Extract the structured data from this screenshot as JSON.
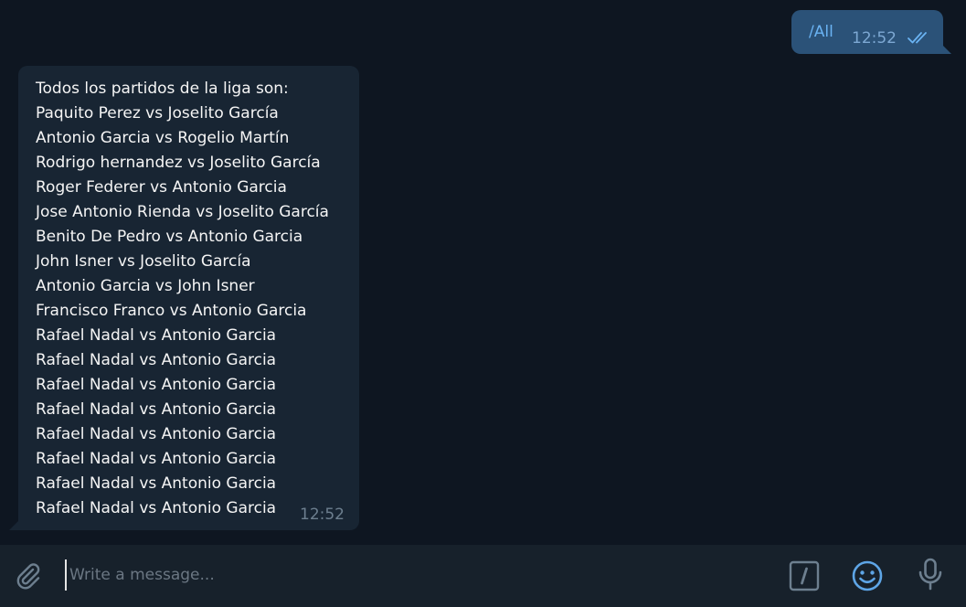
{
  "messages": {
    "outgoing": {
      "text": "/All",
      "time": "12:52",
      "status_icon": "double-check-icon"
    },
    "incoming": {
      "lines": [
        "Todos los partidos de la liga son:",
        "Paquito Perez vs Joselito García",
        "Antonio Garcia vs Rogelio Martín",
        "Rodrigo hernandez vs Joselito García",
        "Roger Federer vs Antonio Garcia",
        "Jose Antonio Rienda vs Joselito García",
        "Benito De Pedro vs Antonio Garcia",
        "John Isner vs Joselito García",
        "Antonio Garcia vs John Isner",
        "Francisco Franco vs Antonio Garcia",
        "Rafael Nadal vs Antonio Garcia",
        "Rafael Nadal vs Antonio Garcia",
        "Rafael Nadal vs Antonio Garcia",
        "Rafael Nadal vs Antonio Garcia",
        "Rafael Nadal vs Antonio Garcia",
        "Rafael Nadal vs Antonio Garcia",
        "Rafael Nadal vs Antonio Garcia",
        "Rafael Nadal vs Antonio Garcia"
      ],
      "time": "12:52"
    }
  },
  "composer": {
    "placeholder": "Write a message...",
    "icons": {
      "attach": "paperclip-icon",
      "commands": "slash-command-icon",
      "emoji": "smiley-icon",
      "voice": "microphone-icon"
    }
  },
  "colors": {
    "chat_background": "#0e1621",
    "outgoing_bubble": "#2b5278",
    "incoming_bubble": "#182533",
    "composer_background": "#17212b",
    "accent": "#6ab3f3",
    "icon_gray": "#6d7f8f"
  }
}
